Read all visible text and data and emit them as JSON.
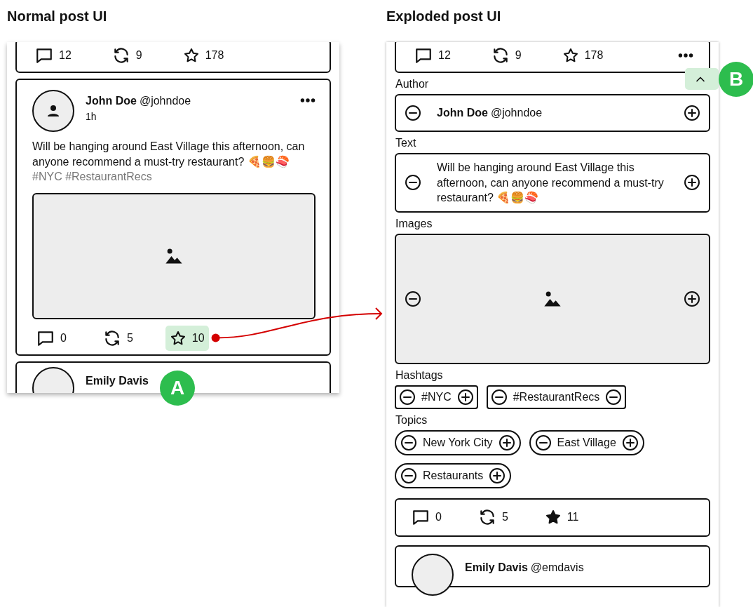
{
  "normal_view": {
    "title": "Normal post UI",
    "previous_post": {
      "stats": [
        {
          "kind": "comments",
          "count": "12"
        },
        {
          "kind": "reposts",
          "count": "9"
        },
        {
          "kind": "stars",
          "count": "178",
          "starred": false
        }
      ]
    },
    "post": {
      "author_name": "John Doe",
      "handle": "@johndoe",
      "time": "1h",
      "text": "Will be hanging around East Village this afternoon, can anyone recommend a must-try restaurant? 🍕🍔🍣",
      "hashtags": "#NYC #RestaurantRecs",
      "stats": [
        {
          "kind": "comments",
          "count": "0",
          "highlighted": false
        },
        {
          "kind": "reposts",
          "count": "5",
          "highlighted": false
        },
        {
          "kind": "stars",
          "count": "10",
          "starred": false,
          "highlighted": true
        }
      ]
    },
    "next_post": {
      "author_name": "Emily Davis"
    }
  },
  "exploded_view": {
    "title": "Exploded post UI",
    "previous_post": {
      "stats": [
        {
          "kind": "comments",
          "count": "12"
        },
        {
          "kind": "reposts",
          "count": "9"
        },
        {
          "kind": "stars",
          "count": "178",
          "starred": false
        }
      ]
    },
    "sections": [
      {
        "label": "Author",
        "kind": "author",
        "author_name": "John Doe",
        "handle": "@johndoe"
      },
      {
        "label": "Text",
        "kind": "text",
        "text": "Will be hanging around East Village this afternoon, can anyone recommend a must-try restaurant? 🍕🍔🍣"
      },
      {
        "label": "Images",
        "kind": "image"
      },
      {
        "label": "Hashtags",
        "kind": "hashtags",
        "chips": [
          {
            "text": "#NYC",
            "kind": "plus"
          },
          {
            "text": "#RestaurantRecs",
            "kind": "minus"
          }
        ]
      },
      {
        "label": "Topics",
        "kind": "topics",
        "chips": [
          {
            "text": "New York City",
            "kind": "plus"
          },
          {
            "text": "East Village",
            "kind": "plus"
          },
          {
            "text": "Restaurants",
            "kind": "plus"
          }
        ]
      }
    ],
    "stats": [
      {
        "kind": "comments",
        "count": "0"
      },
      {
        "kind": "reposts",
        "count": "5"
      },
      {
        "kind": "stars",
        "count": "11",
        "starred": true
      }
    ],
    "next_post": {
      "author_name": "Emily Davis",
      "handle": "@emdavis"
    }
  },
  "annotations": [
    {
      "label": "A"
    },
    {
      "label": "B"
    }
  ]
}
